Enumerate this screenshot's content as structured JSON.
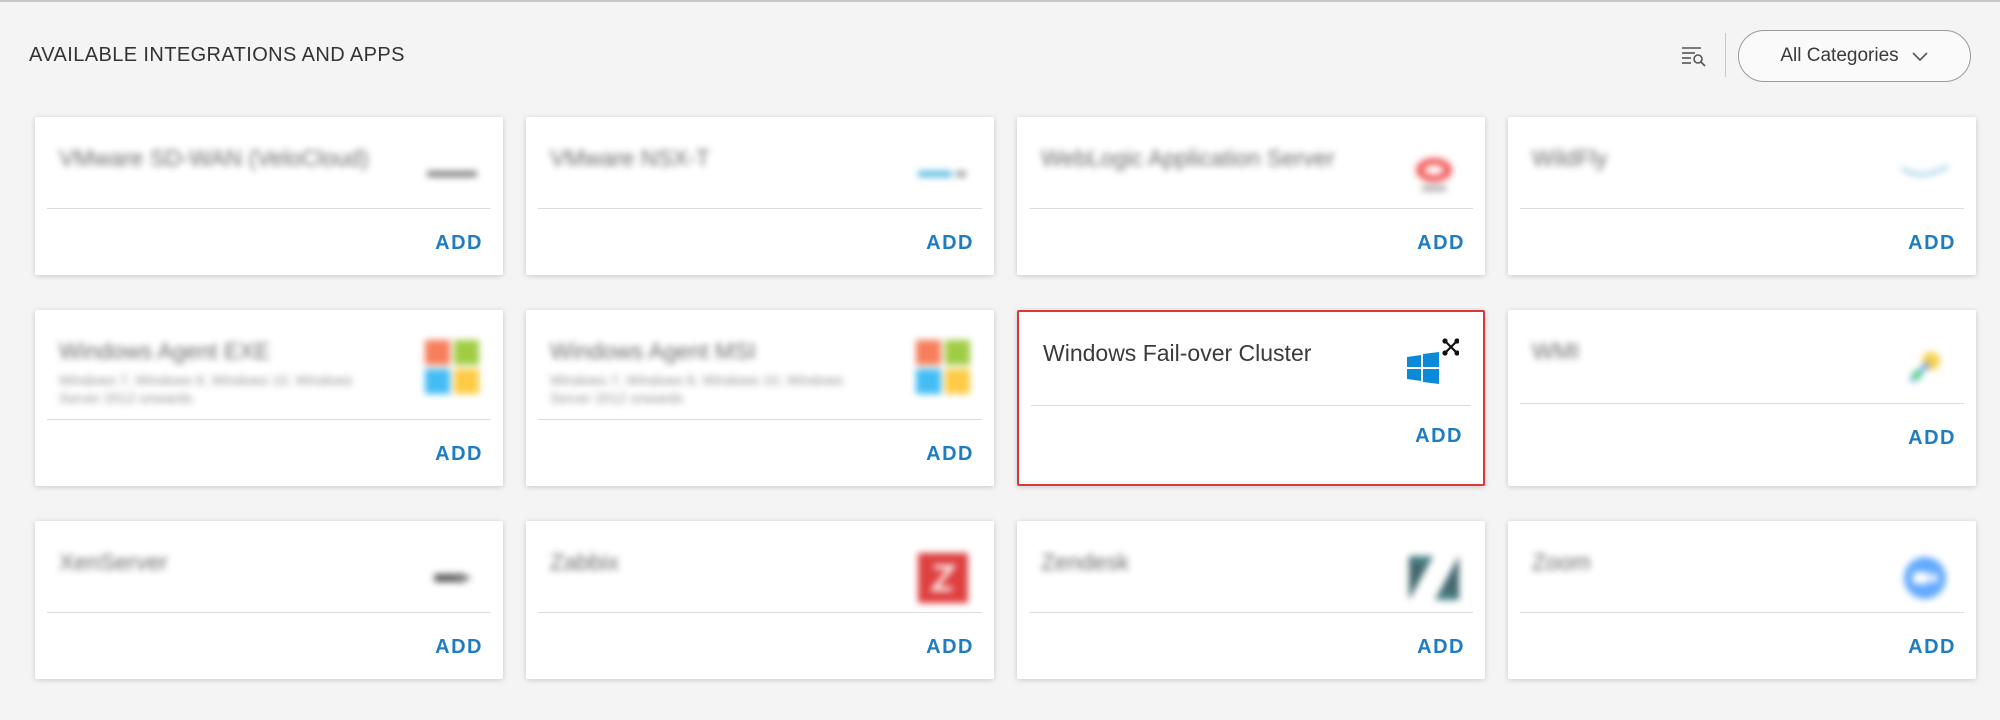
{
  "header": {
    "title": "AVAILABLE INTEGRATIONS AND APPS",
    "category_select": {
      "selected": "All Categories"
    },
    "filter_icon": "filter-list-search-icon"
  },
  "cards": [
    {
      "name": "VMware SD-WAN (VeloCloud)",
      "desc": "",
      "icon": "vmware-sdwan-logo",
      "add": "ADD",
      "blurred": true
    },
    {
      "name": "VMware NSX-T",
      "desc": "",
      "icon": "vmware-nsx-logo",
      "add": "ADD",
      "blurred": true
    },
    {
      "name": "WebLogic Application Server",
      "desc": "",
      "icon": "oracle-logo",
      "add": "ADD",
      "blurred": true
    },
    {
      "name": "WildFly",
      "desc": "",
      "icon": "wildfly-logo",
      "add": "ADD",
      "blurred": true
    },
    {
      "name": "Windows Agent EXE",
      "desc": "Windows 7, Windows 8, Windows 10, Windows Server 2012 onwards",
      "icon": "windows-color-logo",
      "add": "ADD",
      "blurred": true
    },
    {
      "name": "Windows Agent MSI",
      "desc": "Windows 7, Windows 8, Windows 10, Windows Server 2012 onwards",
      "icon": "windows-color-logo",
      "add": "ADD",
      "blurred": true
    },
    {
      "name": "Windows Fail-over Cluster",
      "desc": "",
      "icon": "windows-cluster-logo",
      "add": "ADD",
      "blurred": false,
      "selected": true
    },
    {
      "name": "WMI",
      "desc": "",
      "icon": "wmi-logo",
      "add": "ADD",
      "blurred": true
    },
    {
      "name": "XenServer",
      "desc": "",
      "icon": "xenserver-logo",
      "add": "ADD",
      "blurred": true
    },
    {
      "name": "Zabbix",
      "desc": "",
      "icon": "zabbix-logo",
      "add": "ADD",
      "blurred": true
    },
    {
      "name": "Zendesk",
      "desc": "",
      "icon": "zendesk-logo",
      "add": "ADD",
      "blurred": true
    },
    {
      "name": "Zoom",
      "desc": "",
      "icon": "zoom-logo",
      "add": "ADD",
      "blurred": true
    }
  ],
  "colors": {
    "accent": "#1e7cc2",
    "selected_border": "#d83838",
    "zabbix_red": "#d40000",
    "zendesk_teal": "#03363d",
    "zoom_blue": "#2d8cff",
    "windows_blue": "#0078d7"
  }
}
